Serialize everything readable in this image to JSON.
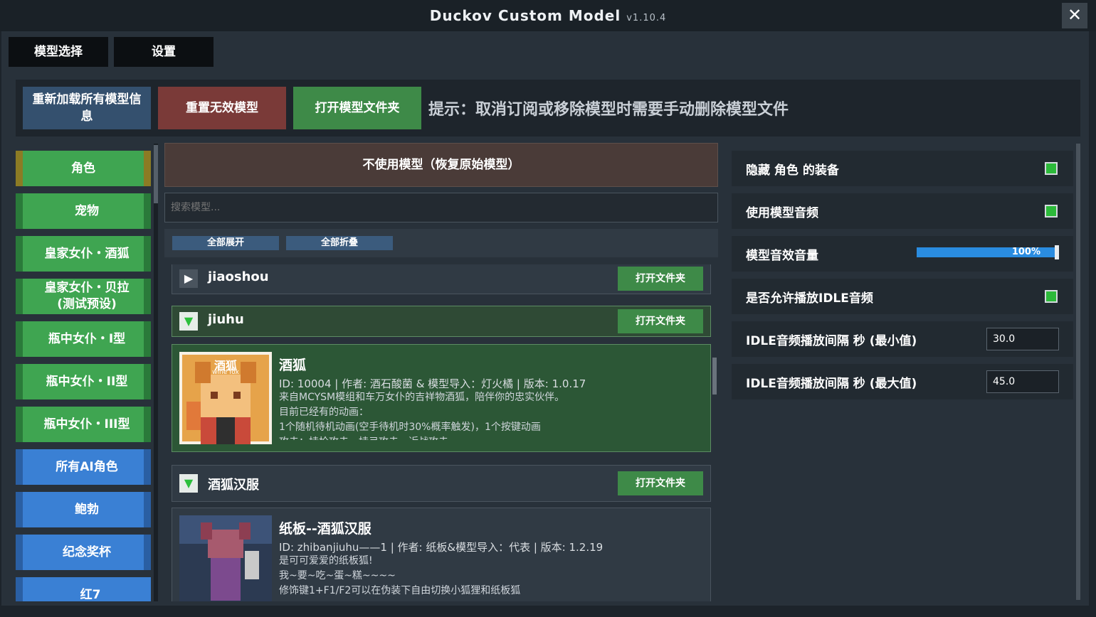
{
  "window": {
    "title": "Duckov Custom Model",
    "version": "v1.10.4",
    "close_glyph": "✕"
  },
  "tabs": [
    {
      "label": "模型选择"
    },
    {
      "label": "设置"
    }
  ],
  "toolbar": {
    "reload_label": "重新加载所有模型信息",
    "reset_label": "重置无效模型",
    "open_folder_label": "打开模型文件夹",
    "hint": "提示：取消订阅或移除模型时需要手动删除模型文件"
  },
  "categories": [
    {
      "label": "角色",
      "color": "green",
      "selected": true
    },
    {
      "label": "宠物",
      "color": "green"
    },
    {
      "label": "皇家女仆・酒狐",
      "color": "green"
    },
    {
      "label": "皇家女仆・贝拉\n(测试预设)",
      "color": "green"
    },
    {
      "label": "瓶中女仆・I型",
      "color": "green"
    },
    {
      "label": "瓶中女仆・II型",
      "color": "green"
    },
    {
      "label": "瓶中女仆・III型",
      "color": "green"
    },
    {
      "label": "所有AI角色",
      "color": "blue"
    },
    {
      "label": "鲍勃",
      "color": "blue"
    },
    {
      "label": "纪念奖杯",
      "color": "blue"
    },
    {
      "label": "红7",
      "color": "blue"
    }
  ],
  "list": {
    "no_model_label": "不使用模型（恢复原始模型）",
    "search_placeholder": "搜索模型...",
    "expand_all": "全部展开",
    "collapse_all": "全部折叠",
    "open_folder": "打开文件夹",
    "groups": [
      {
        "name": "jiaoshou",
        "expanded": false
      },
      {
        "name": "jiuhu",
        "expanded": true
      },
      {
        "name": "酒狐汉服",
        "expanded": true
      }
    ],
    "cards": [
      {
        "name": "酒狐",
        "meta": "ID: 10004 | 作者: 酒石酸菌 & 模型导入：灯火橘 | 版本: 1.0.17",
        "desc": "来自MCYSM模组和车万女仆的吉祥物酒狐，陪伴你的忠实伙伴。\n目前已经有的动画：\n1个随机待机动画(空手待机时30%概率触发)，1个按键动画\n攻击：持枪攻击，持弓攻击，近战攻击",
        "thumb_text": "酒狐",
        "thumb_sub": "wine fox"
      },
      {
        "name": "纸板--酒狐汉服",
        "meta": "ID: zhibanjiuhu——1 | 作者: 纸板&模型导入：代表 | 版本: 1.2.19",
        "desc": "是可可爱爱的纸板狐!\n我~要~吃~蛋~糕~~~~\n修饰键1+F1/F2可以在伪装下自由切换小狐狸和纸板狐"
      }
    ]
  },
  "settings": {
    "hide_equipment": {
      "label": "隐藏 角色 的装备",
      "checked": true
    },
    "use_model_audio": {
      "label": "使用模型音频",
      "checked": true
    },
    "volume": {
      "label": "模型音效音量",
      "value_text": "100%",
      "value": 1.0
    },
    "allow_idle": {
      "label": "是否允许播放IDLE音频",
      "checked": true
    },
    "idle_min": {
      "label": "IDLE音频播放间隔 秒 (最小值)",
      "value": "30.0"
    },
    "idle_max": {
      "label": "IDLE音频播放间隔 秒 (最大值)",
      "value": "45.0"
    }
  }
}
